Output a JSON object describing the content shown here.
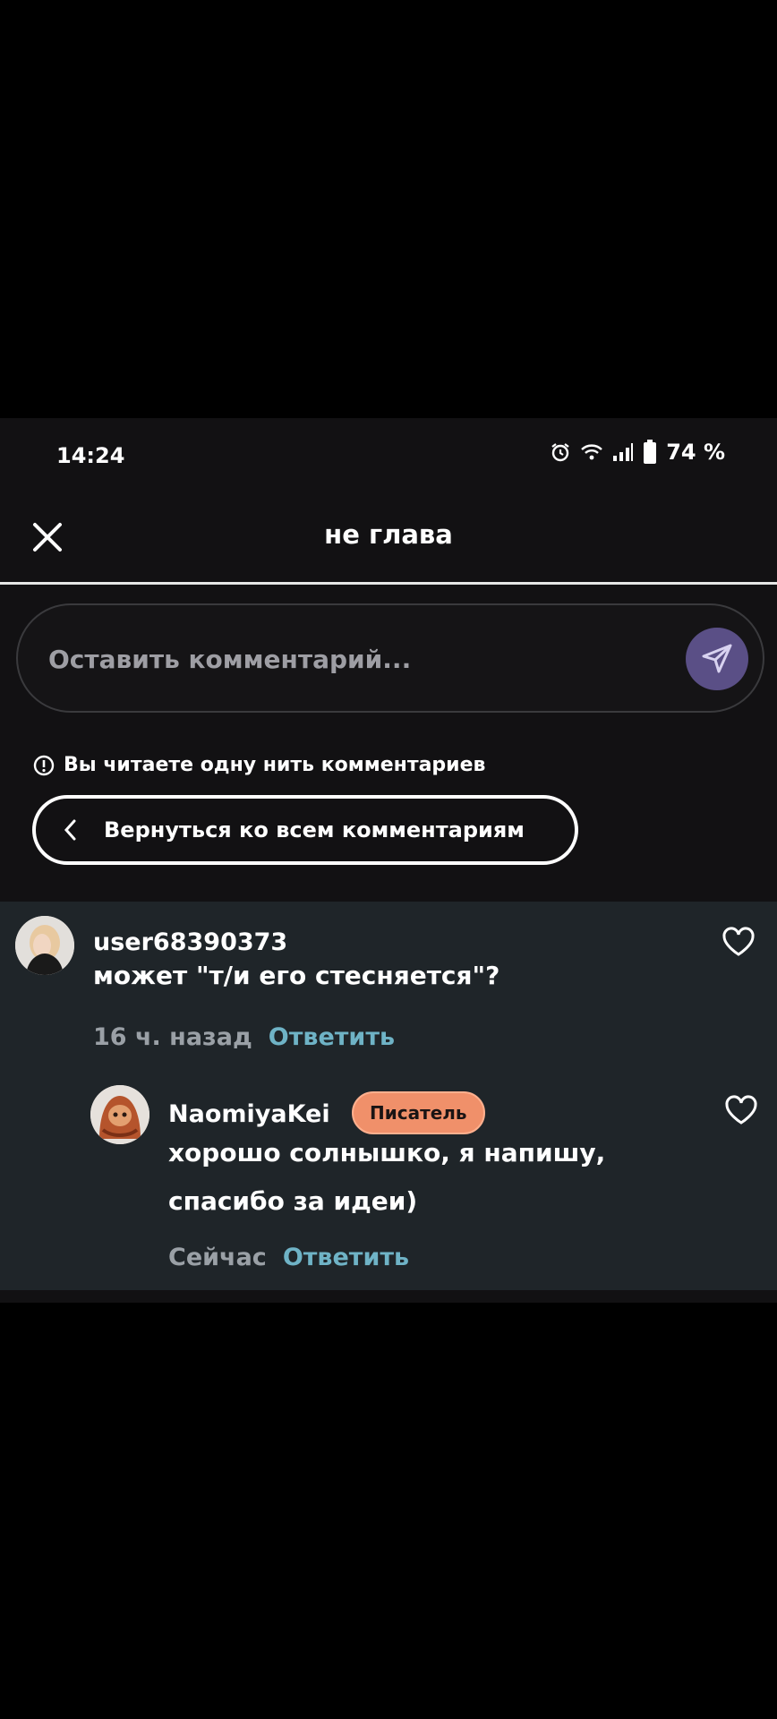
{
  "status_bar": {
    "time": "14:24",
    "battery": "74 %",
    "icons": [
      "alarm-icon",
      "wifi-icon",
      "signal-icon",
      "battery-icon"
    ]
  },
  "header": {
    "title": "не глава",
    "close_icon": "close-icon"
  },
  "comment_box": {
    "placeholder": "Оставить комментарий...",
    "send_icon": "send-icon",
    "send_color": "#5a4f86"
  },
  "thread_note": {
    "icon": "info-icon",
    "text": "Вы читаете одну нить комментариев"
  },
  "back_button": {
    "label": "Вернуться ко всем комментариям",
    "icon": "chevron-left-icon"
  },
  "comments": [
    {
      "username": "user68390373",
      "text": "может \"т/и его стесняется\"?",
      "time": "16 ч. назад",
      "reply_label": "Ответить"
    },
    {
      "username": "NaomiyaKei",
      "badge": "Писатель",
      "text_line1": "хорошо солнышко, я напишу,",
      "text_line2": "спасибо за идеи)",
      "time": "Сейчас",
      "reply_label": "Ответить"
    }
  ],
  "colors": {
    "app_bg": "#121113",
    "thread_bg": "#1f2529",
    "link": "#6fb3c6",
    "badge_bg": "#f0906a"
  }
}
